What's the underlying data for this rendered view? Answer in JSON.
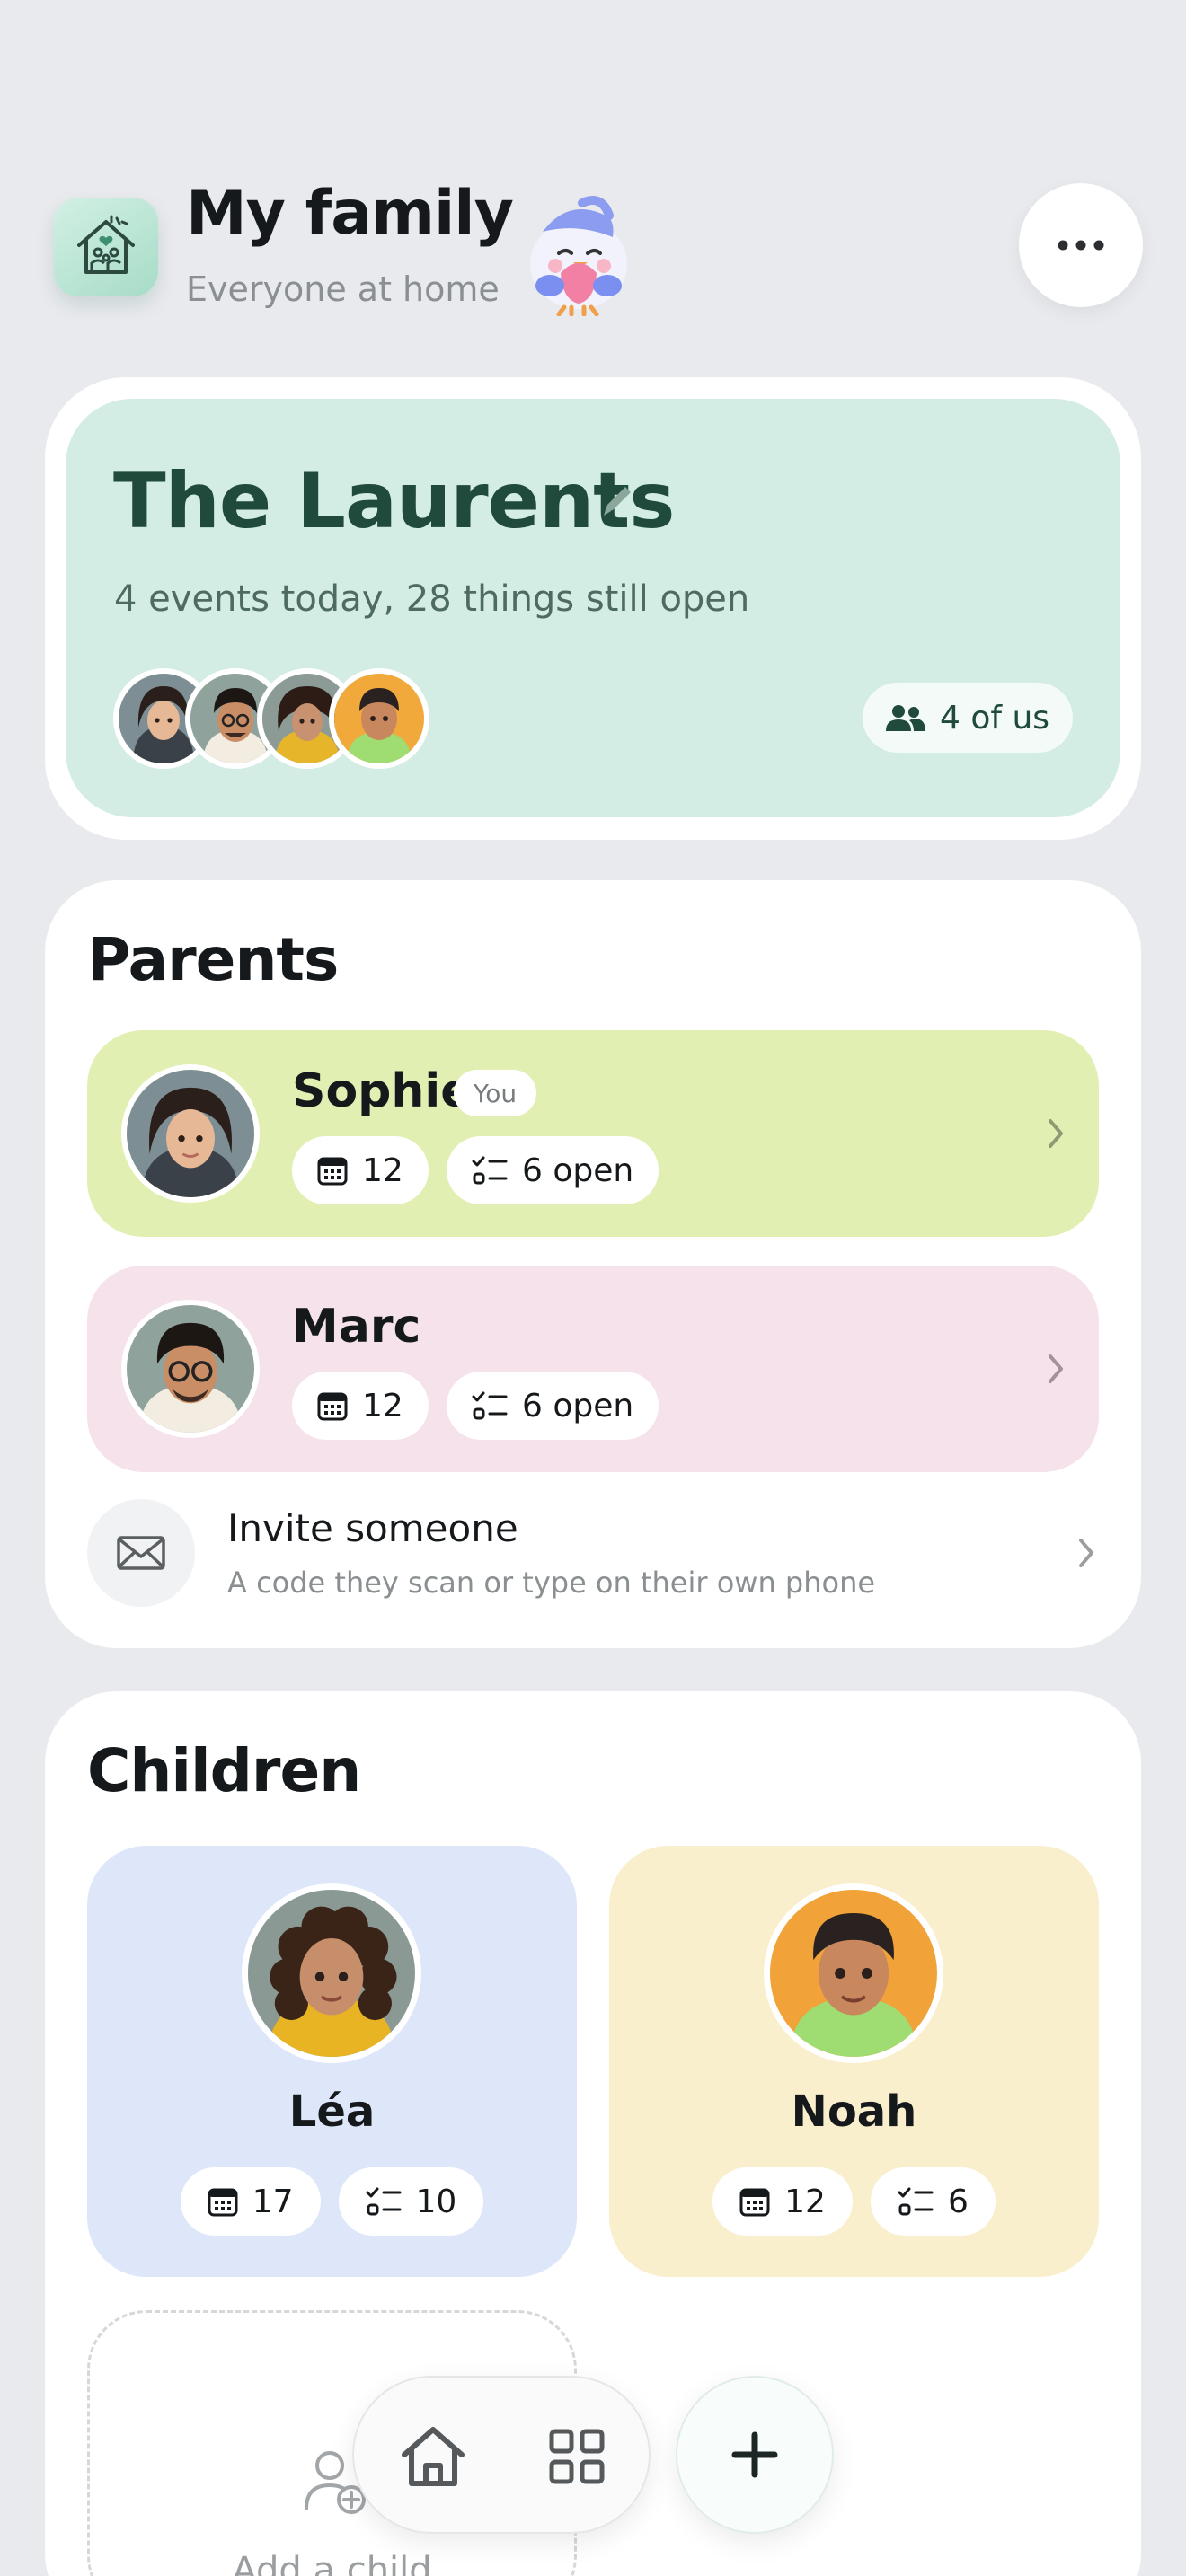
{
  "header": {
    "title": "My family",
    "subtitle": "Everyone at home",
    "logo_icon": "family-house-icon",
    "mascot_icon": "bird-mascot-icon",
    "more_icon": "more-horizontal-icon"
  },
  "family": {
    "name": "The Laurents",
    "summary": "4 events today, 28 things still open",
    "member_count_label": "4 of us",
    "edit_icon": "pencil-icon",
    "members_icon": "people-icon"
  },
  "parents": {
    "title": "Parents",
    "items": [
      {
        "name": "Sophie",
        "badge": "You",
        "events": "12",
        "tasks": "6 open",
        "color": "#e1f0b2"
      },
      {
        "name": "Marc",
        "badge": "",
        "events": "12",
        "tasks": "6 open",
        "color": "#f5e2ea"
      }
    ],
    "invite": {
      "title": "Invite someone",
      "subtitle": "A code they scan or type on their own phone",
      "icon": "mail-icon"
    }
  },
  "children": {
    "title": "Children",
    "items": [
      {
        "name": "Léa",
        "events": "17",
        "tasks": "10",
        "color": "#dee7f9"
      },
      {
        "name": "Noah",
        "events": "12",
        "tasks": "6",
        "color": "#faefcc"
      }
    ],
    "add_label": "Add a child",
    "add_icon": "add-person-icon"
  },
  "nav": {
    "home_icon": "home-icon",
    "grid_icon": "grid-icon",
    "add_icon": "plus-icon"
  },
  "colors": {
    "background": "#e9eaee",
    "hero": "#d3ede4",
    "hero_text": "#1f4a3c"
  }
}
